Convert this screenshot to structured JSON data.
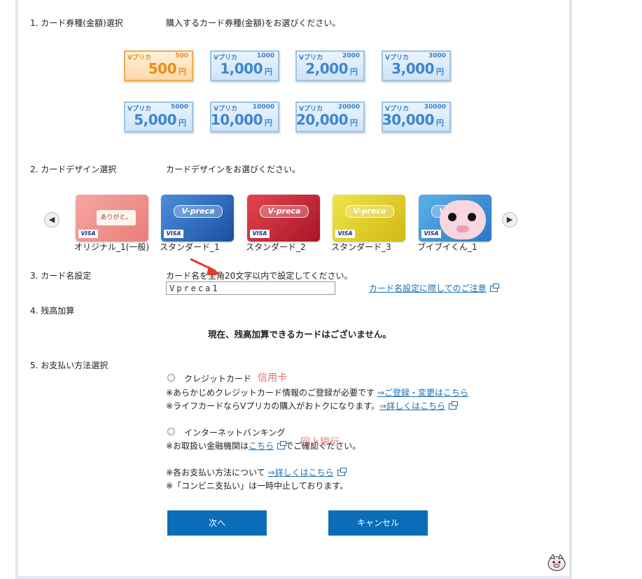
{
  "sections": {
    "amount": {
      "label": "1. カード券種(金額)選択",
      "desc": "購入するカード券種(金額)をお選びください。"
    },
    "design": {
      "label": "2. カードデザイン選択",
      "desc": "カードデザインをお選びください。"
    },
    "name": {
      "label": "3. カード名設定",
      "desc": "カード名を全角20文字以内で設定してください。",
      "value": "Vpreca1",
      "notice_link": "カード名設定に際してのご注意"
    },
    "balance": {
      "label": "4. 残高加算",
      "message": "現在、残高加算できるカードはございません。"
    },
    "payment": {
      "label": "5. お支払い方法選択",
      "credit": {
        "label": "クレジットカード",
        "annotation": "信用卡",
        "line1": "※あらかじめクレジットカード情報のご登録が必要です",
        "line1_link": "⇒ご登録・変更はこちら",
        "line2": "※ライフカードならVプリカの購入がおトクになります。",
        "line2_link": "⇒詳しくはこちら"
      },
      "banking": {
        "label": "インターネットバンキング",
        "annotation": "网上银行",
        "line1_pre": "※お取扱い金融機関は",
        "line1_link": "こちら",
        "line1_post": "でご確認ください。"
      },
      "note1": "※各お支払い方法について",
      "note1_link": "⇒詳しくはこちら",
      "note2": "※「コンビニ支払い」は一時中止しております。"
    }
  },
  "amount_cards": [
    {
      "brand": "Vプリカ",
      "small": "500",
      "big": "500",
      "yen": "円",
      "selected": true
    },
    {
      "brand": "Vプリカ",
      "small": "1000",
      "big": "1,000",
      "yen": "円",
      "selected": false
    },
    {
      "brand": "Vプリカ",
      "small": "2000",
      "big": "2,000",
      "yen": "円",
      "selected": false
    },
    {
      "brand": "Vプリカ",
      "small": "3000",
      "big": "3,000",
      "yen": "円",
      "selected": false
    },
    {
      "brand": "Vプリカ",
      "small": "5000",
      "big": "5,000",
      "yen": "円",
      "selected": false
    },
    {
      "brand": "Vプリカ",
      "small": "10000",
      "big": "10,000",
      "yen": "円",
      "selected": false
    },
    {
      "brand": "Vプリカ",
      "small": "20000",
      "big": "20,000",
      "yen": "円",
      "selected": false
    },
    {
      "brand": "Vプリカ",
      "small": "30000",
      "big": "30,000",
      "yen": "円",
      "selected": false
    }
  ],
  "design_cards": [
    {
      "caption": "オリジナル_1(一般)",
      "logo": "",
      "handwriting": "ありがと。",
      "colors": [
        "#f6a7a3",
        "#e97d78"
      ]
    },
    {
      "caption": "スタンダード_1",
      "logo": "V-preca",
      "colors": [
        "#4a8fdb",
        "#1d4fa3"
      ]
    },
    {
      "caption": "スタンダード_2",
      "logo": "V-preca",
      "colors": [
        "#e3454b",
        "#a8162a"
      ]
    },
    {
      "caption": "スタンダード_3",
      "logo": "V-preca",
      "colors": [
        "#f1e44a",
        "#d0b914"
      ]
    },
    {
      "caption": "ブイブイくん_1",
      "logo": "V-preca",
      "colors": [
        "#5cb1e8",
        "#2a78c9"
      ]
    }
  ],
  "design_card_visa": "VISA",
  "carousel": {
    "prev": "◀",
    "next": "▶"
  },
  "buttons": {
    "next": "次へ",
    "cancel": "キャンセル"
  },
  "colors": {
    "button_bg": "#0b6db8",
    "link": "#1a6fb3",
    "annotation_red": "#e06b6b",
    "frame": "#dfe8f2"
  }
}
